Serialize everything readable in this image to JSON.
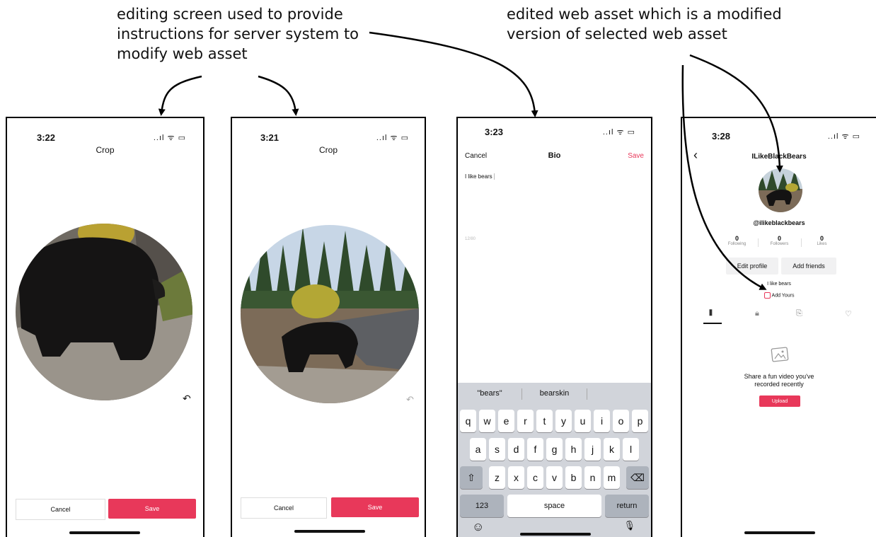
{
  "annotations": {
    "left": [
      "editing screen used to provide",
      "instructions for server system to",
      "modify web asset"
    ],
    "right": [
      "edited web asset which is a modified",
      "version of selected web asset"
    ]
  },
  "phone1": {
    "time": "3:22",
    "status": "..ıl ᯤ ▭",
    "title": "Crop",
    "cancel": "Cancel",
    "save": "Save",
    "undo": "↶"
  },
  "phone2": {
    "time": "3:21",
    "status": "..ıl ᯤ ▭",
    "title": "Crop",
    "cancel": "Cancel",
    "save": "Save",
    "undo": "↶"
  },
  "phone3": {
    "time": "3:23",
    "status": "..ıl ᯤ ▭",
    "cancel": "Cancel",
    "title": "Bio",
    "save": "Save",
    "bio_text": "I like bears",
    "counter": "12/80",
    "suggestions": [
      "\"bears\"",
      "bearskin",
      ""
    ],
    "keyboard": {
      "row1": [
        "q",
        "w",
        "e",
        "r",
        "t",
        "y",
        "u",
        "i",
        "o",
        "p"
      ],
      "row2": [
        "a",
        "s",
        "d",
        "f",
        "g",
        "h",
        "j",
        "k",
        "l"
      ],
      "row3": [
        "z",
        "x",
        "c",
        "v",
        "b",
        "n",
        "m"
      ],
      "shift": "⇧",
      "backspace": "⌫",
      "numbers": "123",
      "space": "space",
      "return": "return",
      "emoji": "☺",
      "mic": "🎙"
    }
  },
  "phone4": {
    "time": "3:28",
    "status": "..ıl ᯤ ▭",
    "back": "‹",
    "username_title": "ILikeBlackBears",
    "handle": "@ilikeblackbears",
    "stats": [
      {
        "num": "0",
        "label": "Following"
      },
      {
        "num": "0",
        "label": "Followers"
      },
      {
        "num": "0",
        "label": "Likes"
      }
    ],
    "edit_profile": "Edit profile",
    "add_friends": "Add friends",
    "bio": "I like bears",
    "add_yours": "Add Yours",
    "empty_title": [
      "Share a fun video you've",
      "recorded recently"
    ],
    "upload": "Upload"
  },
  "colors": {
    "accent": "#e8385a"
  }
}
